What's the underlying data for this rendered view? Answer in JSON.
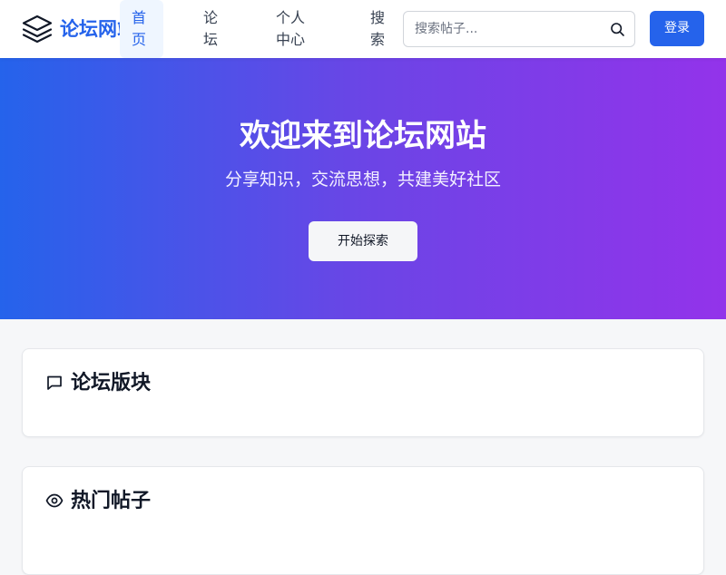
{
  "header": {
    "logo_text": "论坛网站",
    "nav": {
      "home": "首页",
      "forum": "论坛",
      "me": "个人中心",
      "search": "搜索"
    },
    "search": {
      "placeholder": "搜索帖子...",
      "value": ""
    },
    "login_label": "登录",
    "active_nav": "home"
  },
  "hero": {
    "title": "欢迎来到论坛网站",
    "subtitle": "分享知识，交流思想，共建美好社区",
    "cta_label": "开始探索"
  },
  "sections": [
    {
      "title": "论坛版块",
      "icon": "message-square-icon"
    },
    {
      "title": "热门帖子",
      "icon": "eye-icon"
    }
  ],
  "colors": {
    "brand": "#2563eb",
    "gradient_start": "#2563eb",
    "gradient_end": "#9333ea",
    "page_background": "#f6f7f9"
  }
}
